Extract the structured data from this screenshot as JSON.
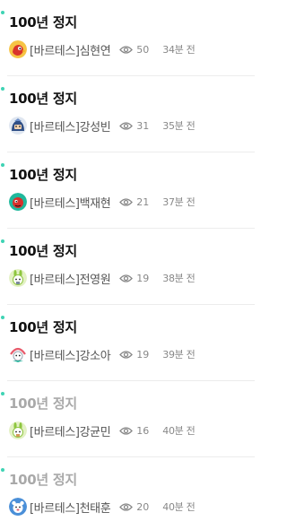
{
  "colors": {
    "accent_dot": "#3fd3b4",
    "title": "#111111",
    "title_faded": "#a9a9a9",
    "meta": "#888888"
  },
  "posts": [
    {
      "title": "100년 정지",
      "author": "[바르테스]심현연",
      "views": "50",
      "time": "34분 전",
      "read": false,
      "avatar_icon": "red-bird-avatar-icon"
    },
    {
      "title": "100년 정지",
      "author": "[바르테스]강성빈",
      "views": "31",
      "time": "35분 전",
      "read": false,
      "avatar_icon": "blue-knight-avatar-icon"
    },
    {
      "title": "100년 정지",
      "author": "[바르테스]백재현",
      "views": "21",
      "time": "37분 전",
      "read": false,
      "avatar_icon": "teal-creature-avatar-icon"
    },
    {
      "title": "100년 정지",
      "author": "[바르테스]전영원",
      "views": "19",
      "time": "38분 전",
      "read": false,
      "avatar_icon": "green-bunny-avatar-icon"
    },
    {
      "title": "100년 정지",
      "author": "[바르테스]강소아",
      "views": "19",
      "time": "39분 전",
      "read": false,
      "avatar_icon": "pink-cat-avatar-icon"
    },
    {
      "title": "100년 정지",
      "author": "[바르테스]강균민",
      "views": "16",
      "time": "40분 전",
      "read": true,
      "avatar_icon": "green-bunny-avatar-icon"
    },
    {
      "title": "100년 정지",
      "author": "[바르테스]천태훈",
      "views": "20",
      "time": "40분 전",
      "read": true,
      "avatar_icon": "blue-bear-avatar-icon"
    }
  ]
}
